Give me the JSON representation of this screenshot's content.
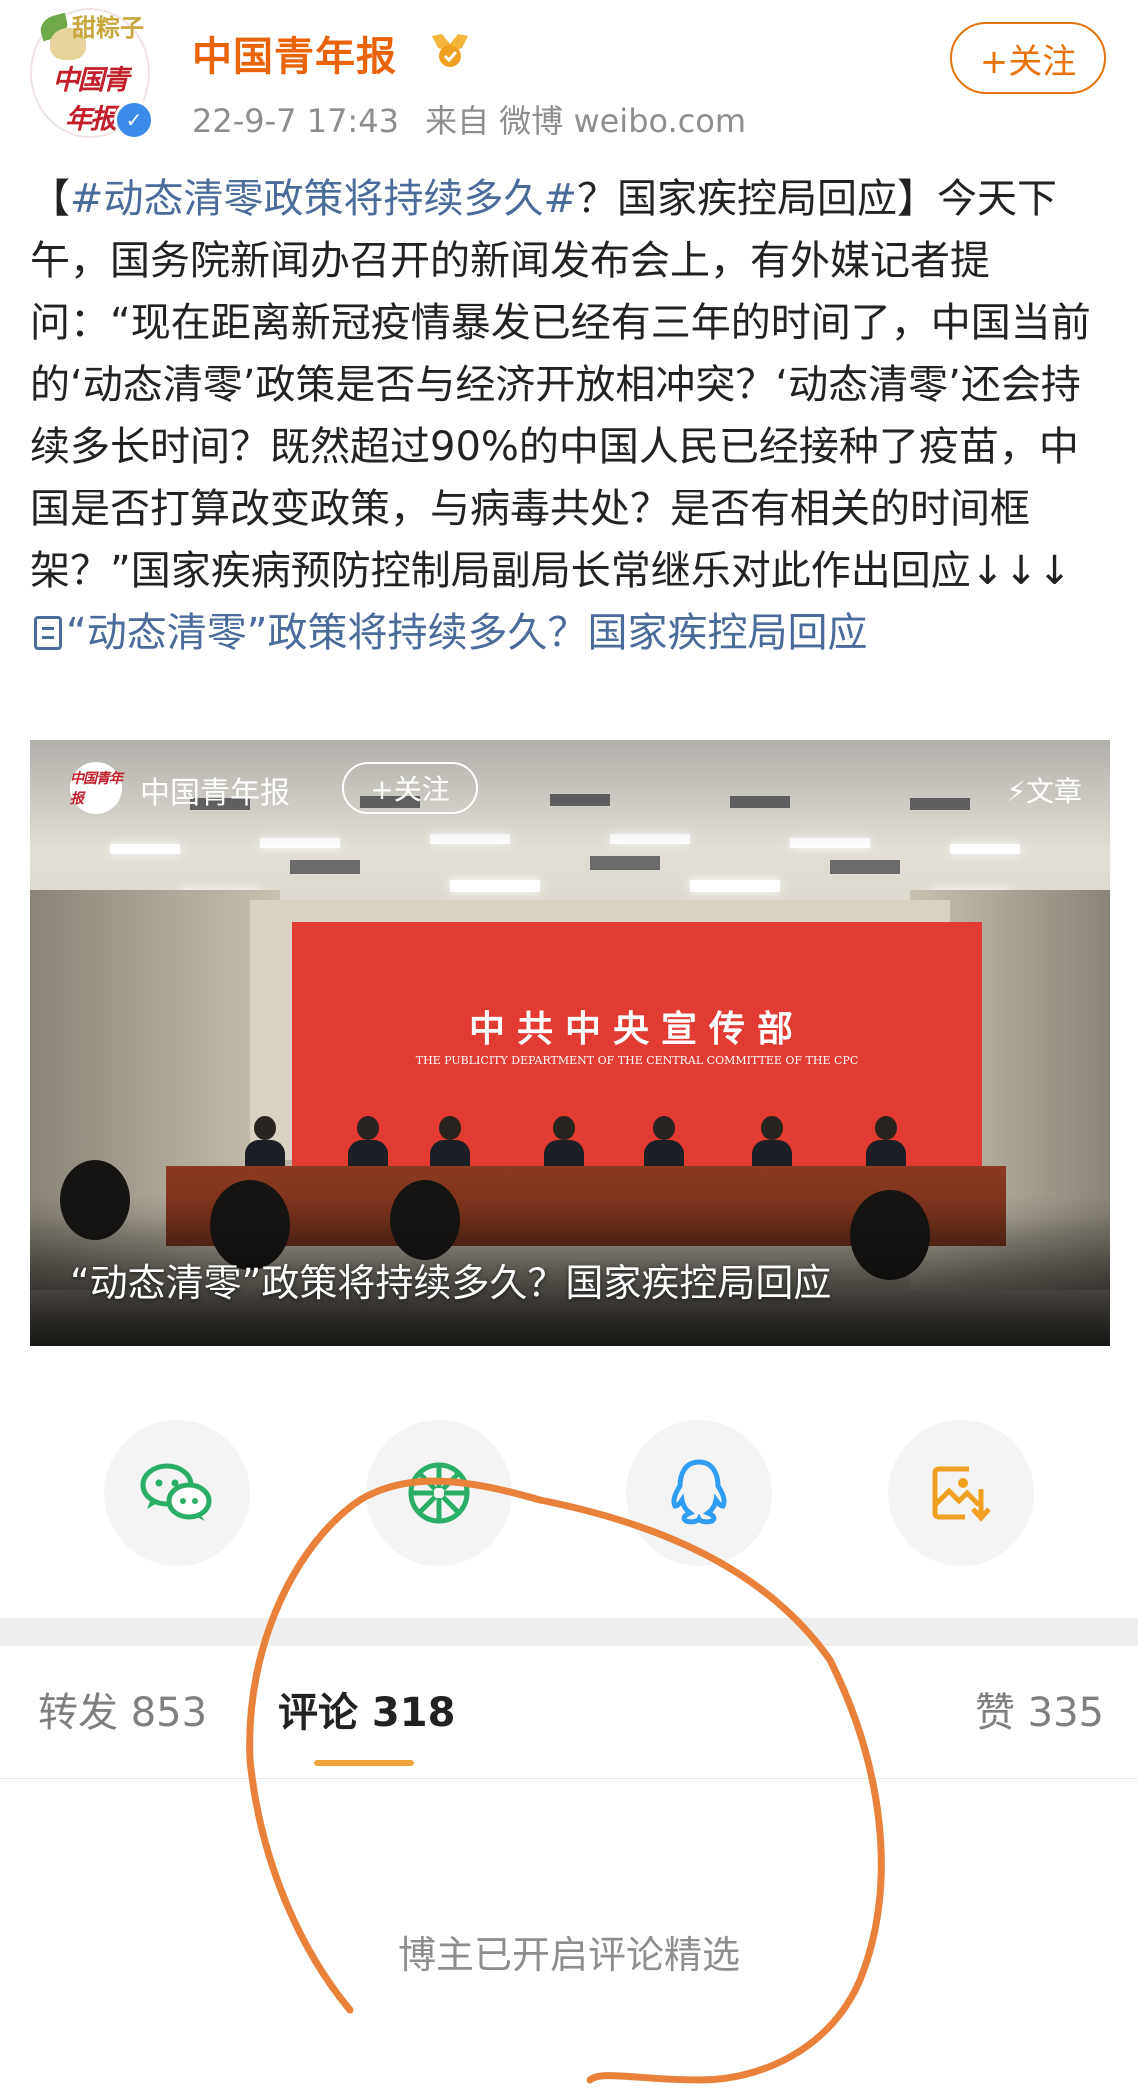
{
  "header": {
    "account_name": "中国青年报",
    "post_time": "22-9-7 17:43",
    "source": "来自 微博 weibo.com",
    "follow_label": "+关注",
    "avatar_seal_top": "甜粽子",
    "avatar_seal_main": "中国青年报"
  },
  "post": {
    "bracket_open": "【",
    "hashtag": "#动态清零政策将持续多久#",
    "headline_rest": "？国家疾控局回应】",
    "body": "今天下午，国务院新闻办召开的新闻发布会上，有外媒记者提问：“现在距离新冠疫情暴发已经有三年的时间了，中国当前的‘动态清零’政策是否与经济开放相冲突？‘动态清零’还会持续多长时间？既然超过90%的中国人民已经接种了疫苗，中国是否打算改变政策，与病毒共处？是否有相关的时间框架？”国家疾病预防控制局副局长常继乐对此作出回应↓↓↓",
    "link_text": "“动态清零”政策将持续多久？国家疾控局回应"
  },
  "article_card": {
    "source_name": "中国青年报",
    "logo_text": "中国青年报",
    "follow_label": "+关注",
    "type_label": "文章",
    "backdrop_title": "中共中央宣传部",
    "backdrop_subtitle": "THE PUBLICITY DEPARTMENT OF THE CENTRAL COMMITTEE OF THE CPC",
    "caption": "“动态清零”政策将持续多久？国家疾控局回应"
  },
  "share": {
    "icons": [
      "wechat-icon",
      "moments-icon",
      "qq-icon",
      "save-image-icon"
    ],
    "colors": {
      "wechat": "#2aae67",
      "moments": "#2aae67",
      "qq": "#2f9df2",
      "save": "#f0a020"
    }
  },
  "tabs": {
    "repost": "转发 853",
    "comments": "评论 318",
    "likes": "赞 335"
  },
  "comments": {
    "notice": "博主已开启评论精选"
  },
  "colors": {
    "accent_orange": "#e8630a",
    "link_blue": "#4b6b9b",
    "tab_indicator": "#f0a23a",
    "annotation": "#e8813a"
  }
}
